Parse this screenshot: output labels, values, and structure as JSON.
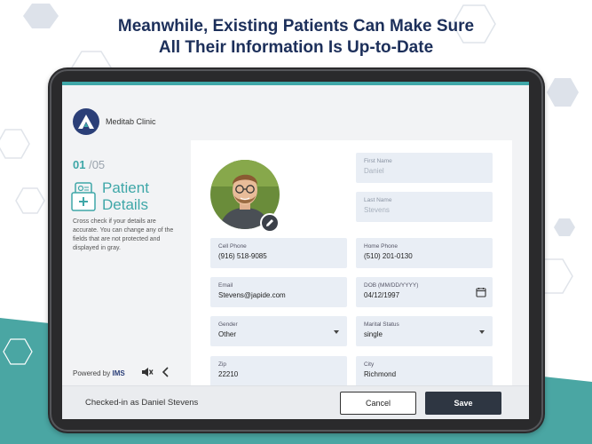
{
  "headline": {
    "line1": "Meanwhile, Existing Patients Can Make Sure",
    "line2": "All Their Information Is Up-to-Date"
  },
  "clinic": {
    "name": "Meditab Clinic"
  },
  "step": {
    "current": "01",
    "total": "/05"
  },
  "section": {
    "title_line1": "Patient",
    "title_line2": "Details",
    "description": "Cross check if your details are accurate. You can change any of the fields that are not protected and displayed in gray."
  },
  "footer_left": {
    "powered_by": "Powered by",
    "brand": "IMS"
  },
  "form": {
    "first_name": {
      "label": "First Name",
      "value": "Daniel"
    },
    "last_name": {
      "label": "Last Name",
      "value": "Stevens"
    },
    "cell_phone": {
      "label": "Cell Phone",
      "value": "(916) 518-9085"
    },
    "home_phone": {
      "label": "Home Phone",
      "value": "(510) 201-0130"
    },
    "email": {
      "label": "Email",
      "value": "Stevens@japide.com"
    },
    "dob": {
      "label": "DOB (MM/DD/YYYY)",
      "value": "04/12/1997"
    },
    "gender": {
      "label": "Gender",
      "value": "Other"
    },
    "marital_status": {
      "label": "Marital Status",
      "value": "single"
    },
    "zip": {
      "label": "Zip",
      "value": "22210"
    },
    "city": {
      "label": "City",
      "value": "Richmond"
    }
  },
  "bottom_bar": {
    "checked_in": "Checked-in as Daniel Stevens",
    "cancel_label": "Cancel",
    "save_label": "Save"
  },
  "colors": {
    "teal": "#3fa7a8",
    "navy": "#1c2f5a",
    "save_button": "#2e3642",
    "field_bg": "#e9eef5"
  },
  "icons": {
    "logo": "meditab-logo-icon",
    "section": "patient-details-icon",
    "edit": "pencil-icon",
    "calendar": "calendar-icon",
    "mute": "speaker-mute-icon",
    "back": "chevron-left-icon"
  }
}
